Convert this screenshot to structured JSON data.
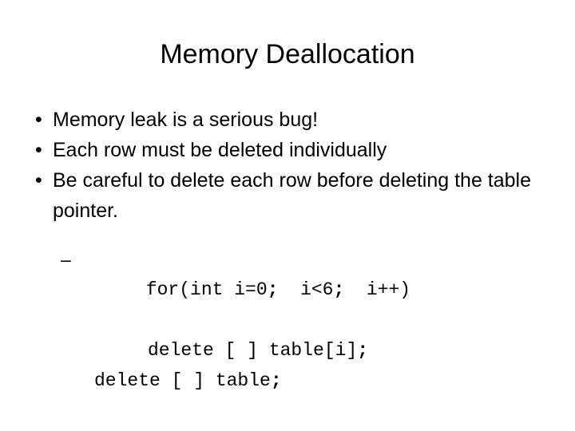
{
  "slide": {
    "title": "Memory Deallocation",
    "background_color": "#ffffff",
    "text_color": "#000000",
    "bullet_glyph": "•",
    "sub_bullet_glyph": "–",
    "bullets": [
      {
        "text": "Memory leak is a serious bug!"
      },
      {
        "text": "Each row must be deleted individually"
      },
      {
        "text": "Be careful to delete each row before deleting the table pointer."
      }
    ],
    "code_lines": [
      {
        "text": "for(int i=0;  i<6;  i++)",
        "has_sub_bullet": true
      },
      {
        "text": "delete [ ] table[i];",
        "has_sub_bullet": false
      },
      {
        "text": "delete [ ] table;",
        "has_sub_bullet": false
      }
    ]
  }
}
